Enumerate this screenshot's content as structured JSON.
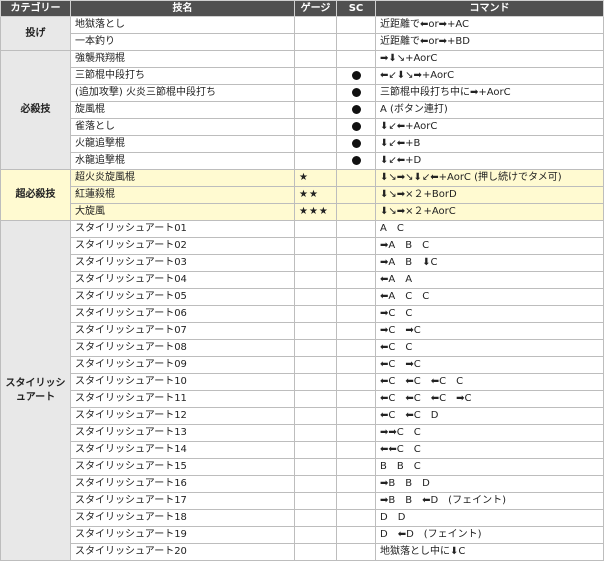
{
  "headers": {
    "category": "カテゴリー",
    "name": "技名",
    "gauge": "ゲージ",
    "sc": "SC",
    "command": "コマンド"
  },
  "categories": [
    {
      "label": "投げ",
      "type": "normal",
      "rows": [
        {
          "name": "地獄落とし",
          "gauge": "",
          "sc": false,
          "command": "近距離で⬅or➡+AC"
        },
        {
          "name": "一本釣り",
          "gauge": "",
          "sc": false,
          "command": "近距離で⬅or➡+BD"
        }
      ]
    },
    {
      "label": "必殺技",
      "type": "normal",
      "rows": [
        {
          "name": "強襲飛翔棍",
          "gauge": "",
          "sc": false,
          "command": "➡⬇↘+AorC"
        },
        {
          "name": "三節棍中段打ち",
          "gauge": "",
          "sc": true,
          "command": "⬅↙⬇↘➡+AorC"
        },
        {
          "name": "(追加攻撃) 火炎三節棍中段打ち",
          "gauge": "",
          "sc": true,
          "command": "三節棍中段打ち中に➡+AorC"
        },
        {
          "name": "旋風棍",
          "gauge": "",
          "sc": true,
          "command": "A (ボタン連打)"
        },
        {
          "name": "雀落とし",
          "gauge": "",
          "sc": true,
          "command": "⬇↙⬅+AorC"
        },
        {
          "name": "火龍追撃棍",
          "gauge": "",
          "sc": true,
          "command": "⬇↙⬅+B"
        },
        {
          "name": "水龍追撃棍",
          "gauge": "",
          "sc": true,
          "command": "⬇↙⬅+D"
        }
      ]
    },
    {
      "label": "超必殺技",
      "type": "super",
      "rows": [
        {
          "name": "超火炎旋風棍",
          "gauge": "★",
          "sc": false,
          "command": "⬇↘➡↘⬇↙⬅+AorC (押し続けでタメ可)"
        },
        {
          "name": "紅蓮殺棍",
          "gauge": "★★",
          "sc": false,
          "command": "⬇↘➡×２+BorD"
        },
        {
          "name": "大旋風",
          "gauge": "★★★",
          "sc": false,
          "command": "⬇↘➡×２+AorC"
        }
      ]
    },
    {
      "label": "スタイリッシュアート",
      "type": "normal",
      "rows": [
        {
          "name": "スタイリッシュアート01",
          "gauge": "",
          "sc": false,
          "command": "A　C"
        },
        {
          "name": "スタイリッシュアート02",
          "gauge": "",
          "sc": false,
          "command": "➡A　B　C"
        },
        {
          "name": "スタイリッシュアート03",
          "gauge": "",
          "sc": false,
          "command": "➡A　B　⬇C"
        },
        {
          "name": "スタイリッシュアート04",
          "gauge": "",
          "sc": false,
          "command": "⬅A　A"
        },
        {
          "name": "スタイリッシュアート05",
          "gauge": "",
          "sc": false,
          "command": "⬅A　C　C"
        },
        {
          "name": "スタイリッシュアート06",
          "gauge": "",
          "sc": false,
          "command": "➡C　C"
        },
        {
          "name": "スタイリッシュアート07",
          "gauge": "",
          "sc": false,
          "command": "➡C　➡C"
        },
        {
          "name": "スタイリッシュアート08",
          "gauge": "",
          "sc": false,
          "command": "⬅C　C"
        },
        {
          "name": "スタイリッシュアート09",
          "gauge": "",
          "sc": false,
          "command": "⬅C　➡C"
        },
        {
          "name": "スタイリッシュアート10",
          "gauge": "",
          "sc": false,
          "command": "⬅C　⬅C　⬅C　C"
        },
        {
          "name": "スタイリッシュアート11",
          "gauge": "",
          "sc": false,
          "command": "⬅C　⬅C　⬅C　➡C"
        },
        {
          "name": "スタイリッシュアート12",
          "gauge": "",
          "sc": false,
          "command": "⬅C　⬅C　D"
        },
        {
          "name": "スタイリッシュアート13",
          "gauge": "",
          "sc": false,
          "command": "➡➡C　C"
        },
        {
          "name": "スタイリッシュアート14",
          "gauge": "",
          "sc": false,
          "command": "⬅⬅C　C"
        },
        {
          "name": "スタイリッシュアート15",
          "gauge": "",
          "sc": false,
          "command": "B　B　C"
        },
        {
          "name": "スタイリッシュアート16",
          "gauge": "",
          "sc": false,
          "command": "➡B　B　D"
        },
        {
          "name": "スタイリッシュアート17",
          "gauge": "",
          "sc": false,
          "command": "➡B　B　⬅D　(フェイント)"
        },
        {
          "name": "スタイリッシュアート18",
          "gauge": "",
          "sc": false,
          "command": "D　D"
        },
        {
          "name": "スタイリッシュアート19",
          "gauge": "",
          "sc": false,
          "command": "D　⬅D　(フェイント)"
        },
        {
          "name": "スタイリッシュアート20",
          "gauge": "",
          "sc": false,
          "command": "地獄落とし中に⬇C"
        }
      ]
    }
  ]
}
